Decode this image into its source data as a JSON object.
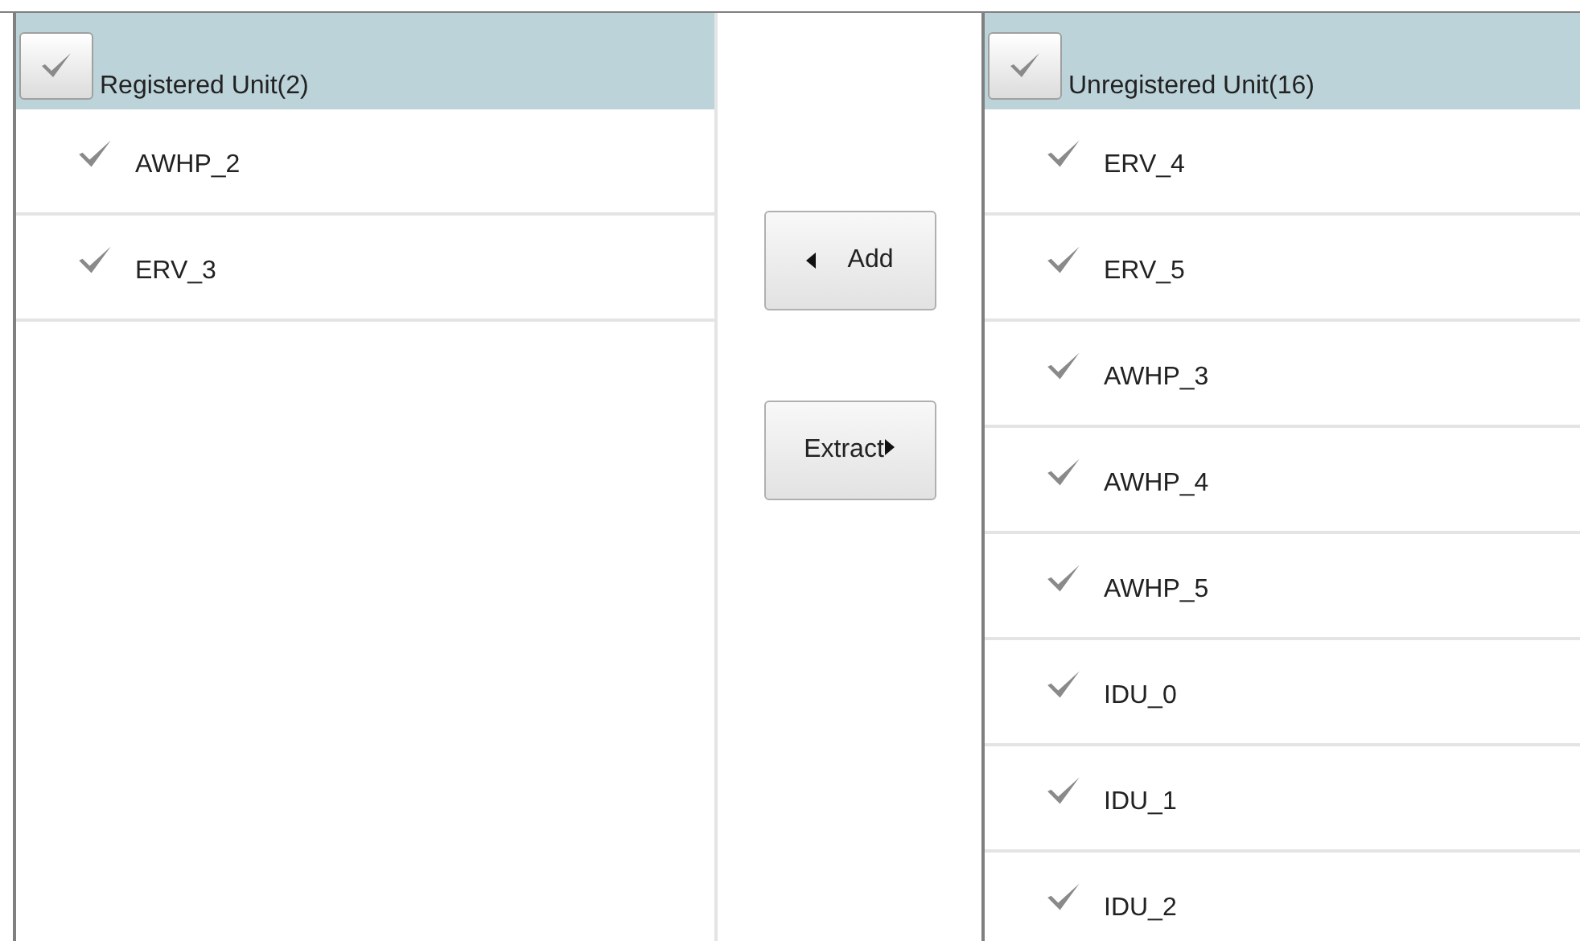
{
  "registered": {
    "title": "Registered Unit(2)",
    "checked": false,
    "items": [
      {
        "label": "AWHP_2",
        "checked": false
      },
      {
        "label": "ERV_3",
        "checked": false
      }
    ]
  },
  "buttons": [
    {
      "kind": "add",
      "label": "Add"
    },
    {
      "kind": "extract",
      "label": "Extract"
    }
  ],
  "unregistered": {
    "title": "Unregistered Unit(16)",
    "checked": false,
    "items": [
      {
        "label": "ERV_4",
        "checked": false
      },
      {
        "label": "ERV_5",
        "checked": false
      },
      {
        "label": "AWHP_3",
        "checked": false
      },
      {
        "label": "AWHP_4",
        "checked": false
      },
      {
        "label": "AWHP_5",
        "checked": false
      },
      {
        "label": "IDU_0",
        "checked": false
      },
      {
        "label": "IDU_1",
        "checked": false
      },
      {
        "label": "IDU_2",
        "checked": false
      }
    ]
  }
}
